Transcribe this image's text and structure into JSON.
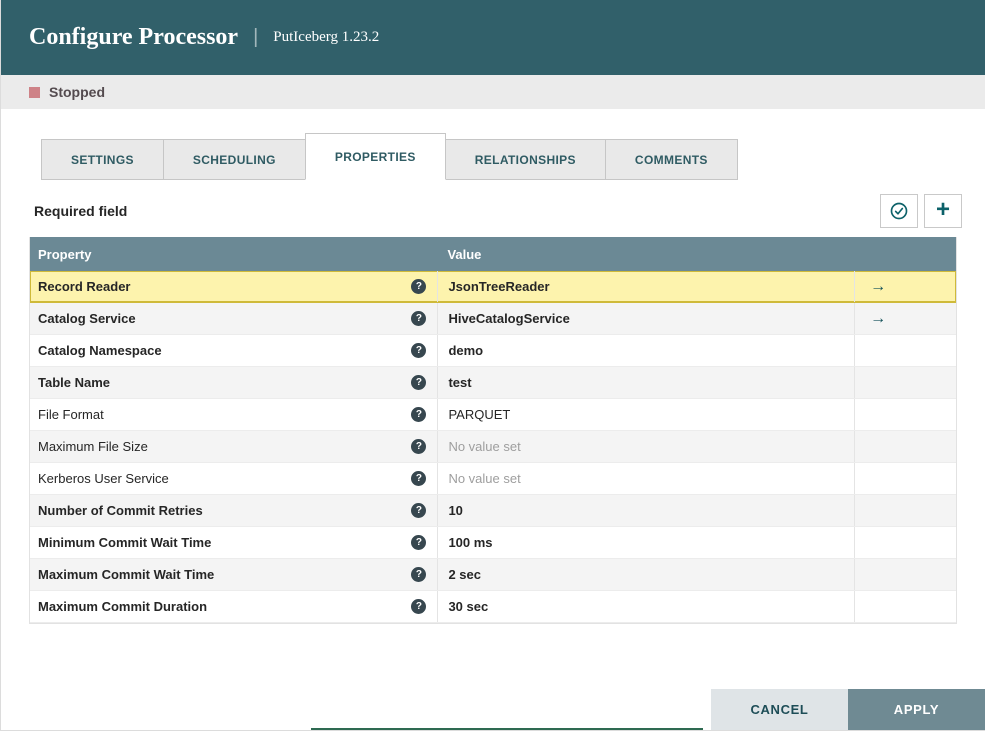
{
  "header": {
    "title": "Configure Processor",
    "divider": "|",
    "subtitle": "PutIceberg 1.23.2"
  },
  "status_bar": {
    "label": "Stopped"
  },
  "tabs": [
    {
      "label": "SETTINGS",
      "active": false
    },
    {
      "label": "SCHEDULING",
      "active": false
    },
    {
      "label": "PROPERTIES",
      "active": true
    },
    {
      "label": "RELATIONSHIPS",
      "active": false
    },
    {
      "label": "COMMENTS",
      "active": false
    }
  ],
  "toolbar": {
    "required_label": "Required field",
    "icons": {
      "verify": "check-circle-icon",
      "add": "plus-icon"
    }
  },
  "table": {
    "columns": [
      "Property",
      "Value"
    ],
    "rows": [
      {
        "property": "Record Reader",
        "required": true,
        "value": "JsonTreeReader",
        "value_set": true,
        "has_goto": true,
        "highlighted": true
      },
      {
        "property": "Catalog Service",
        "required": true,
        "value": "HiveCatalogService",
        "value_set": true,
        "has_goto": true,
        "highlighted": false
      },
      {
        "property": "Catalog Namespace",
        "required": true,
        "value": "demo",
        "value_set": true,
        "has_goto": false,
        "highlighted": false
      },
      {
        "property": "Table Name",
        "required": true,
        "value": "test",
        "value_set": true,
        "has_goto": false,
        "highlighted": false
      },
      {
        "property": "File Format",
        "required": false,
        "value": "PARQUET",
        "value_set": true,
        "has_goto": false,
        "highlighted": false
      },
      {
        "property": "Maximum File Size",
        "required": false,
        "value": "No value set",
        "value_set": false,
        "has_goto": false,
        "highlighted": false
      },
      {
        "property": "Kerberos User Service",
        "required": false,
        "value": "No value set",
        "value_set": false,
        "has_goto": false,
        "highlighted": false
      },
      {
        "property": "Number of Commit Retries",
        "required": true,
        "value": "10",
        "value_set": true,
        "has_goto": false,
        "highlighted": false
      },
      {
        "property": "Minimum Commit Wait Time",
        "required": true,
        "value": "100 ms",
        "value_set": true,
        "has_goto": false,
        "highlighted": false
      },
      {
        "property": "Maximum Commit Wait Time",
        "required": true,
        "value": "2 sec",
        "value_set": true,
        "has_goto": false,
        "highlighted": false
      },
      {
        "property": "Maximum Commit Duration",
        "required": true,
        "value": "30 sec",
        "value_set": true,
        "has_goto": false,
        "highlighted": false
      }
    ]
  },
  "footer": {
    "cancel_label": "CANCEL",
    "apply_label": "APPLY"
  },
  "colors": {
    "header_bg": "#31606a",
    "accent_teal": "#0c6169",
    "table_header_bg": "#6b8995",
    "highlight_bg": "#fdf3ad",
    "highlight_border": "#cfba39",
    "stopped_red": "#ce8287",
    "apply_bg": "#6f8a93",
    "cancel_bg": "#dfe4e7"
  }
}
